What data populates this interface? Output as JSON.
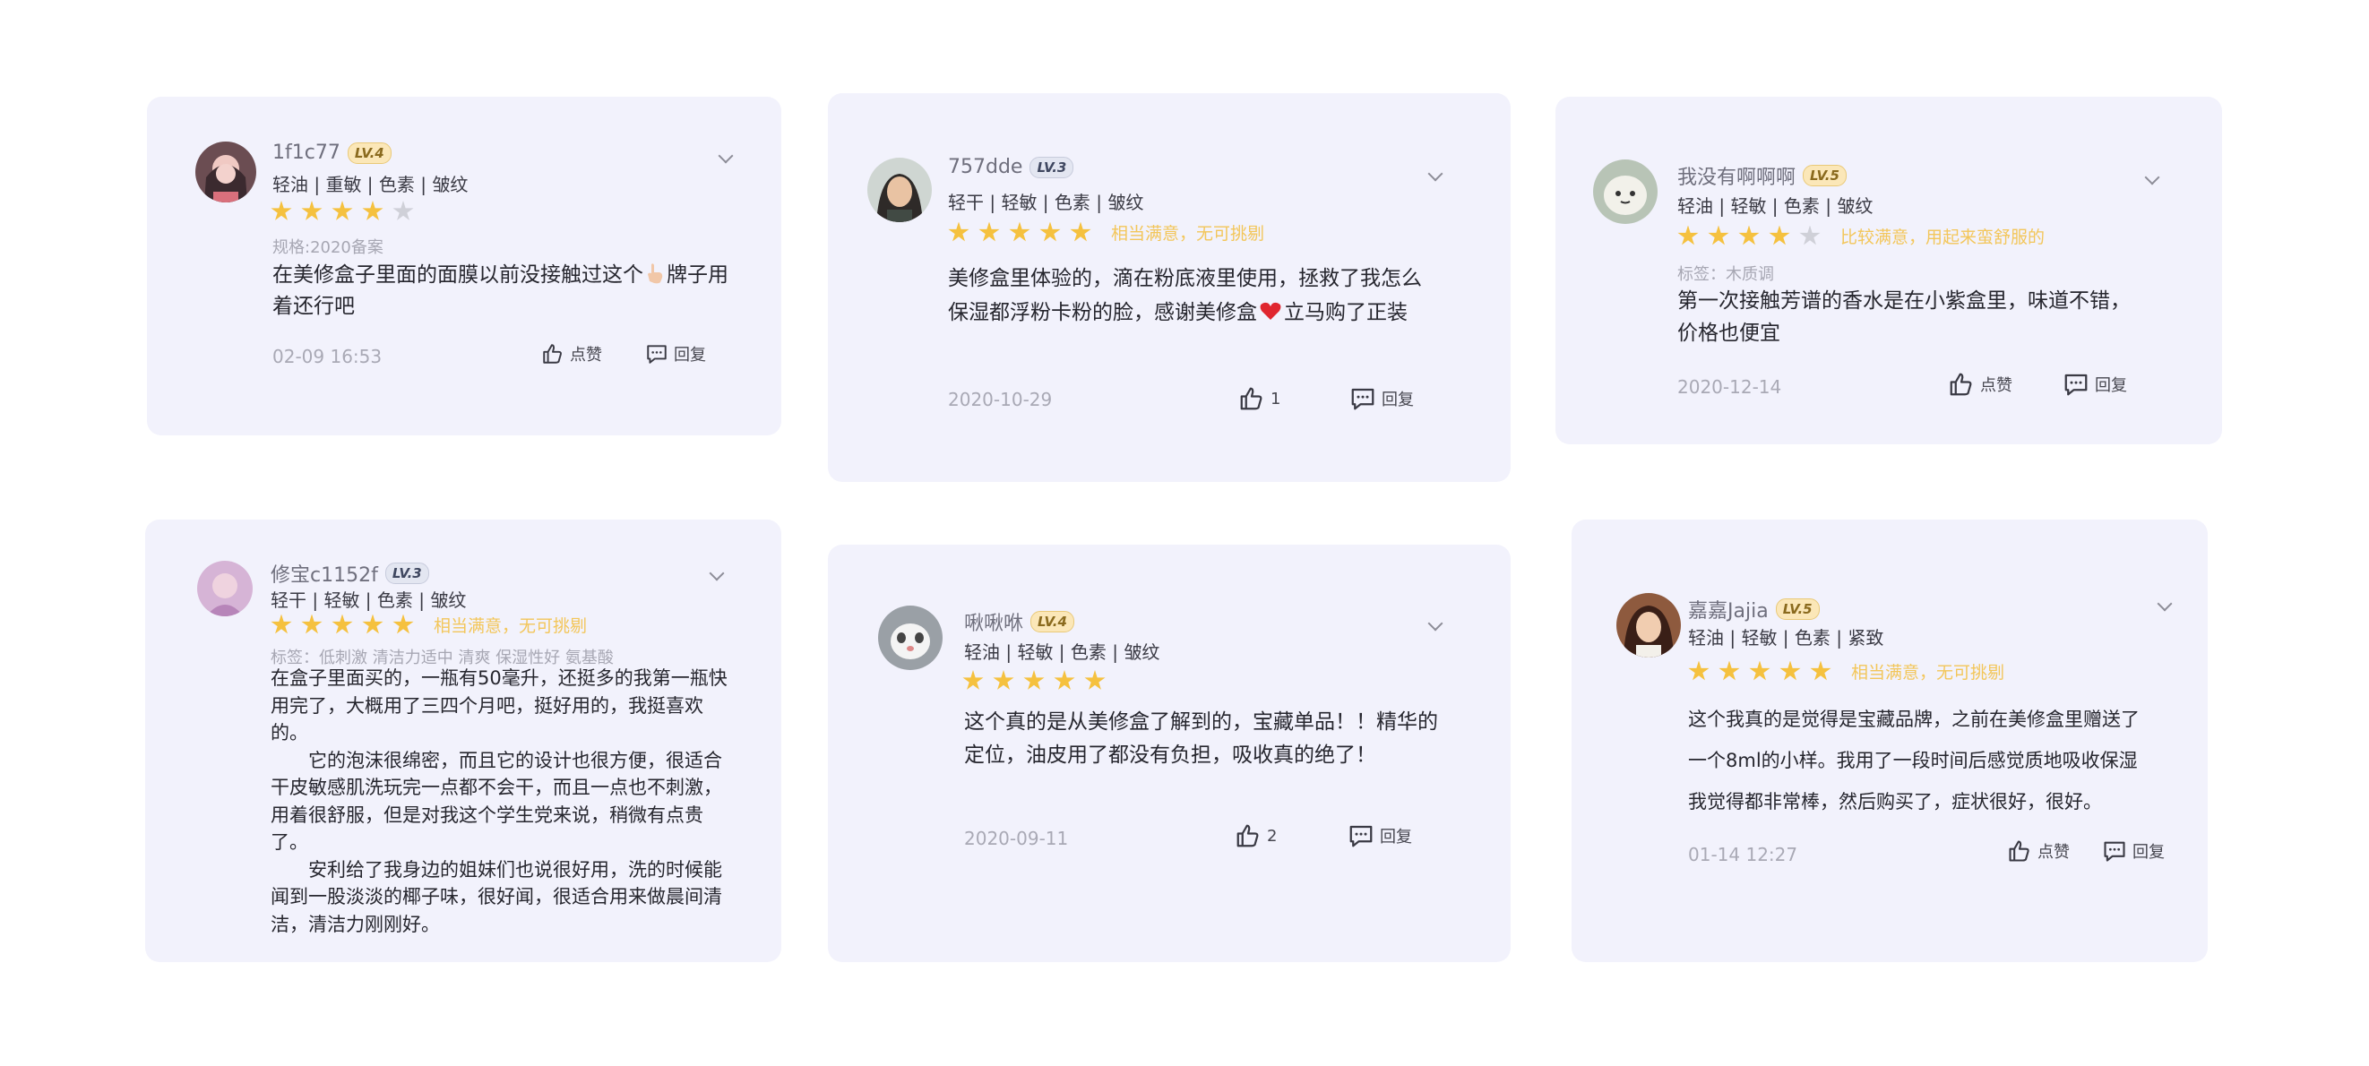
{
  "reviews": [
    {
      "username": "1f1c77",
      "level": "LV.4",
      "attributes": "轻油 | 重敏 | 色素 | 皱纹",
      "rating": 4,
      "rating_text": "",
      "tag": "规格:2020备案",
      "content_parts": [
        "在美修盒子里面的面膜以前没接触过这个",
        "牌子用着还行吧"
      ],
      "date": "02-09 16:53",
      "like_label": "点赞",
      "reply_label": "回复"
    },
    {
      "username": "757dde",
      "level": "LV.3",
      "attributes": "轻干 | 轻敏 | 色素 | 皱纹",
      "rating": 5,
      "rating_text": "相当满意，无可挑剔",
      "tag": "",
      "content_parts": [
        "美修盒里体验的，滴在粉底液里使用，拯救了我怎么保湿都浮粉卡粉的脸，感谢美修盒",
        "立马购了正装"
      ],
      "date": "2020-10-29",
      "like_label": "1",
      "reply_label": "回复"
    },
    {
      "username": "我没有啊啊啊",
      "level": "LV.5",
      "attributes": "轻油 | 轻敏 | 色素 | 皱纹",
      "rating": 4,
      "rating_text": "比较满意，用起来蛮舒服的",
      "tag": "标签：木质调",
      "content_parts": [
        "第一次接触芳谱的香水是在小紫盒里，味道不错，价格也便宜"
      ],
      "date": "2020-12-14",
      "like_label": "点赞",
      "reply_label": "回复"
    },
    {
      "username": "修宝c1152f",
      "level": "LV.3",
      "attributes": "轻干 | 轻敏 | 色素 | 皱纹",
      "rating": 5,
      "rating_text": "相当满意，无可挑剔",
      "tag": "标签：低刺激  清洁力适中  清爽  保湿性好  氨基酸",
      "content_paragraphs": [
        "在盒子里面买的，一瓶有50毫升，还挺多的我第一瓶快用完了，大概用了三四个月吧，挺好用的，我挺喜欢的。",
        "它的泡沫很绵密，而且它的设计也很方便，很适合干皮敏感肌洗玩完一点都不会干，而且一点也不刺激，用着很舒服，但是对我这个学生党来说，稍微有点贵了。",
        "安利给了我身边的姐妹们也说很好用，洗的时候能闻到一股淡淡的椰子味，很好闻，很适合用来做晨间清洁，清洁力刚刚好。"
      ]
    },
    {
      "username": "啾啾咻",
      "level": "LV.4",
      "attributes": "轻油 | 轻敏 | 色素 | 皱纹",
      "rating": 5,
      "rating_text": "",
      "tag": "",
      "content_parts": [
        "这个真的是从美修盒了解到的，宝藏单品！！精华的定位，油皮用了都没有负担，吸收真的绝了！"
      ],
      "date": "2020-09-11",
      "like_label": "2",
      "reply_label": "回复"
    },
    {
      "username": "嘉嘉Jajia",
      "level": "LV.5",
      "attributes": "轻油 | 轻敏 | 色素 | 紧致",
      "rating": 5,
      "rating_text": "相当满意，无可挑剔",
      "tag": "",
      "content_parts": [
        "这个我真的是觉得是宝藏品牌，之前在美修盒里赠送了一个8ml的小样。我用了一段时间后感觉质地吸收保湿我觉得都非常棒，然后购买了，症状很好，很好。"
      ],
      "date": "01-14 12:27",
      "like_label": "点赞",
      "reply_label": "回复"
    }
  ],
  "colors": {
    "card_bg": "#f2f2fc",
    "star": "#f5c13f",
    "star_empty": "#cfd0d8",
    "rating_text": "#f3c65a",
    "meta_text": "#a9a9b5"
  },
  "icons": [
    "avatar-photo",
    "chevron-down-icon",
    "star-icon",
    "thumbs-up-icon",
    "comment-icon",
    "hand-emoji",
    "heart-emoji"
  ]
}
